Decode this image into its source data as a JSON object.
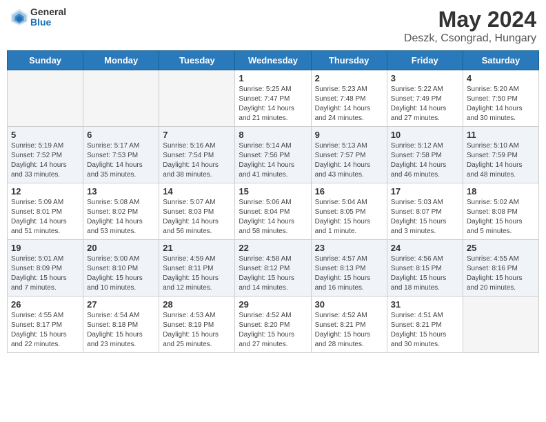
{
  "header": {
    "logo_line1": "General",
    "logo_line2": "Blue",
    "title": "May 2024",
    "subtitle": "Deszk, Csongrad, Hungary"
  },
  "weekdays": [
    "Sunday",
    "Monday",
    "Tuesday",
    "Wednesday",
    "Thursday",
    "Friday",
    "Saturday"
  ],
  "weeks": [
    [
      {
        "day": "",
        "info": ""
      },
      {
        "day": "",
        "info": ""
      },
      {
        "day": "",
        "info": ""
      },
      {
        "day": "1",
        "info": "Sunrise: 5:25 AM\nSunset: 7:47 PM\nDaylight: 14 hours\nand 21 minutes."
      },
      {
        "day": "2",
        "info": "Sunrise: 5:23 AM\nSunset: 7:48 PM\nDaylight: 14 hours\nand 24 minutes."
      },
      {
        "day": "3",
        "info": "Sunrise: 5:22 AM\nSunset: 7:49 PM\nDaylight: 14 hours\nand 27 minutes."
      },
      {
        "day": "4",
        "info": "Sunrise: 5:20 AM\nSunset: 7:50 PM\nDaylight: 14 hours\nand 30 minutes."
      }
    ],
    [
      {
        "day": "5",
        "info": "Sunrise: 5:19 AM\nSunset: 7:52 PM\nDaylight: 14 hours\nand 33 minutes."
      },
      {
        "day": "6",
        "info": "Sunrise: 5:17 AM\nSunset: 7:53 PM\nDaylight: 14 hours\nand 35 minutes."
      },
      {
        "day": "7",
        "info": "Sunrise: 5:16 AM\nSunset: 7:54 PM\nDaylight: 14 hours\nand 38 minutes."
      },
      {
        "day": "8",
        "info": "Sunrise: 5:14 AM\nSunset: 7:56 PM\nDaylight: 14 hours\nand 41 minutes."
      },
      {
        "day": "9",
        "info": "Sunrise: 5:13 AM\nSunset: 7:57 PM\nDaylight: 14 hours\nand 43 minutes."
      },
      {
        "day": "10",
        "info": "Sunrise: 5:12 AM\nSunset: 7:58 PM\nDaylight: 14 hours\nand 46 minutes."
      },
      {
        "day": "11",
        "info": "Sunrise: 5:10 AM\nSunset: 7:59 PM\nDaylight: 14 hours\nand 48 minutes."
      }
    ],
    [
      {
        "day": "12",
        "info": "Sunrise: 5:09 AM\nSunset: 8:01 PM\nDaylight: 14 hours\nand 51 minutes."
      },
      {
        "day": "13",
        "info": "Sunrise: 5:08 AM\nSunset: 8:02 PM\nDaylight: 14 hours\nand 53 minutes."
      },
      {
        "day": "14",
        "info": "Sunrise: 5:07 AM\nSunset: 8:03 PM\nDaylight: 14 hours\nand 56 minutes."
      },
      {
        "day": "15",
        "info": "Sunrise: 5:06 AM\nSunset: 8:04 PM\nDaylight: 14 hours\nand 58 minutes."
      },
      {
        "day": "16",
        "info": "Sunrise: 5:04 AM\nSunset: 8:05 PM\nDaylight: 15 hours\nand 1 minute."
      },
      {
        "day": "17",
        "info": "Sunrise: 5:03 AM\nSunset: 8:07 PM\nDaylight: 15 hours\nand 3 minutes."
      },
      {
        "day": "18",
        "info": "Sunrise: 5:02 AM\nSunset: 8:08 PM\nDaylight: 15 hours\nand 5 minutes."
      }
    ],
    [
      {
        "day": "19",
        "info": "Sunrise: 5:01 AM\nSunset: 8:09 PM\nDaylight: 15 hours\nand 7 minutes."
      },
      {
        "day": "20",
        "info": "Sunrise: 5:00 AM\nSunset: 8:10 PM\nDaylight: 15 hours\nand 10 minutes."
      },
      {
        "day": "21",
        "info": "Sunrise: 4:59 AM\nSunset: 8:11 PM\nDaylight: 15 hours\nand 12 minutes."
      },
      {
        "day": "22",
        "info": "Sunrise: 4:58 AM\nSunset: 8:12 PM\nDaylight: 15 hours\nand 14 minutes."
      },
      {
        "day": "23",
        "info": "Sunrise: 4:57 AM\nSunset: 8:13 PM\nDaylight: 15 hours\nand 16 minutes."
      },
      {
        "day": "24",
        "info": "Sunrise: 4:56 AM\nSunset: 8:15 PM\nDaylight: 15 hours\nand 18 minutes."
      },
      {
        "day": "25",
        "info": "Sunrise: 4:55 AM\nSunset: 8:16 PM\nDaylight: 15 hours\nand 20 minutes."
      }
    ],
    [
      {
        "day": "26",
        "info": "Sunrise: 4:55 AM\nSunset: 8:17 PM\nDaylight: 15 hours\nand 22 minutes."
      },
      {
        "day": "27",
        "info": "Sunrise: 4:54 AM\nSunset: 8:18 PM\nDaylight: 15 hours\nand 23 minutes."
      },
      {
        "day": "28",
        "info": "Sunrise: 4:53 AM\nSunset: 8:19 PM\nDaylight: 15 hours\nand 25 minutes."
      },
      {
        "day": "29",
        "info": "Sunrise: 4:52 AM\nSunset: 8:20 PM\nDaylight: 15 hours\nand 27 minutes."
      },
      {
        "day": "30",
        "info": "Sunrise: 4:52 AM\nSunset: 8:21 PM\nDaylight: 15 hours\nand 28 minutes."
      },
      {
        "day": "31",
        "info": "Sunrise: 4:51 AM\nSunset: 8:21 PM\nDaylight: 15 hours\nand 30 minutes."
      },
      {
        "day": "",
        "info": ""
      }
    ]
  ]
}
